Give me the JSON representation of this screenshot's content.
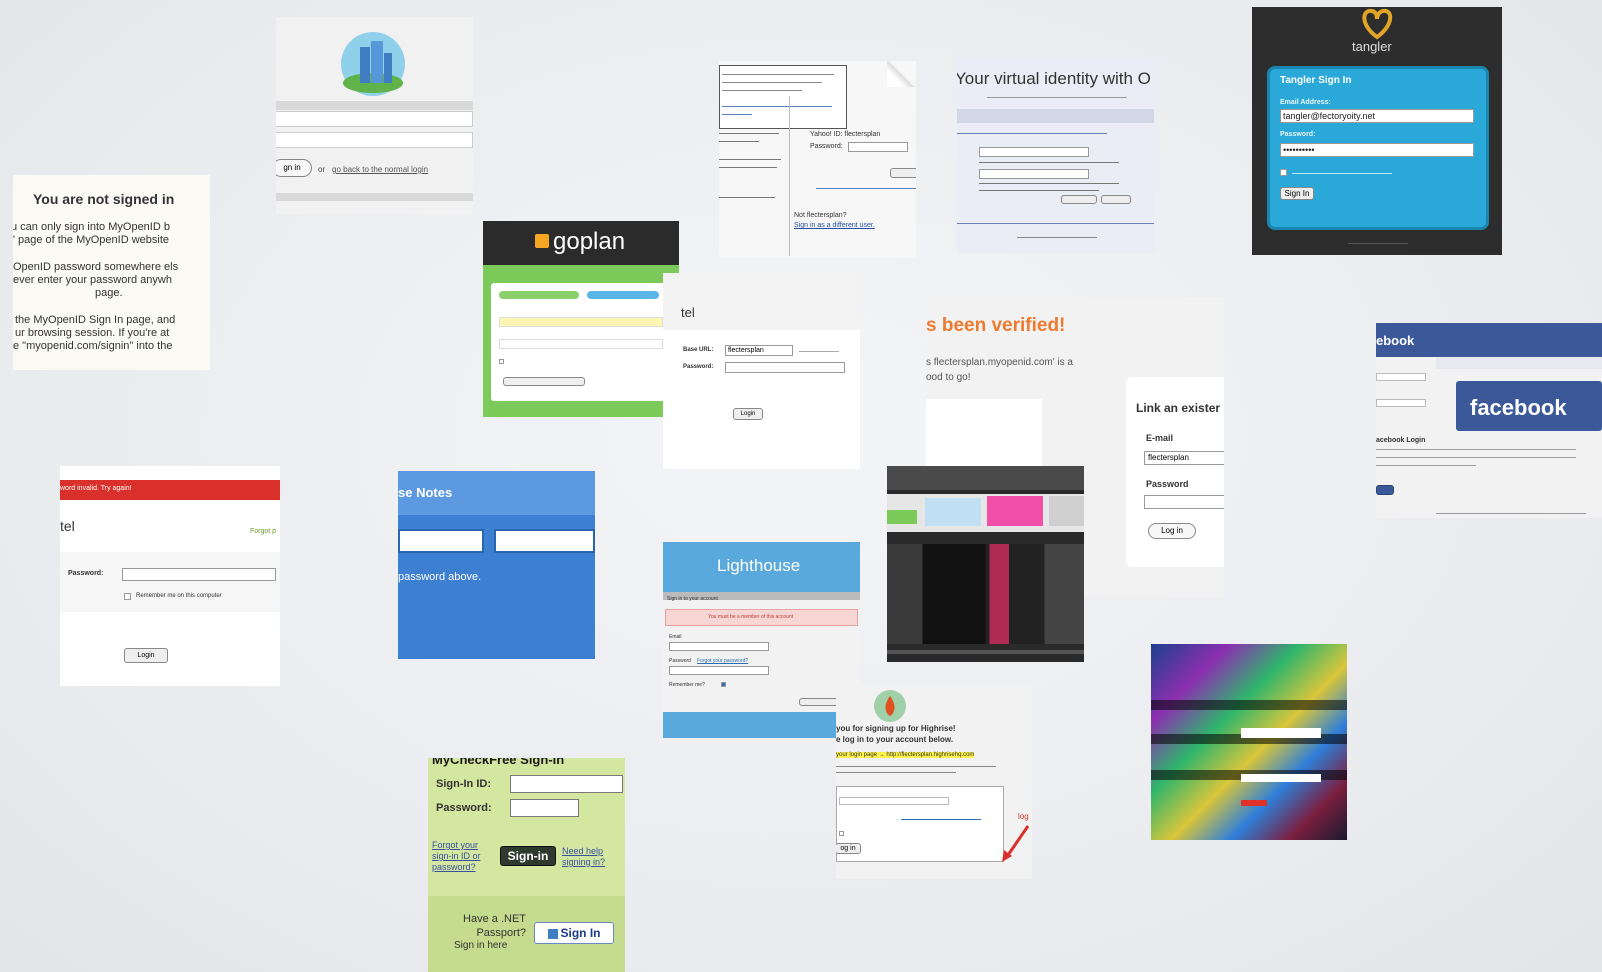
{
  "myopenid_notice": {
    "title": "You are not signed in",
    "lines": [
      "u can only sign into MyOpenID b",
      "\" page of the MyOpenID website",
      "OpenID password somewhere els",
      "ever enter your password anywh",
      "page.",
      "the MyOpenID Sign In page, and",
      "ur browsing session. If you're at",
      "e \"myopenid.com/signin\" into the"
    ]
  },
  "city_login": {
    "signin_button": "gn in",
    "or_text": "or",
    "back_link": "go back to the normal login"
  },
  "goplan": {
    "brand": "goplan"
  },
  "signup_paper": {
    "username_label": "Yahoo! ID: flectersplan",
    "password_label": "Password:",
    "new_link": "Not flectersplan?",
    "sign_in_link": "Sign in as a different user."
  },
  "openid_identity": {
    "heading": "Your virtual identity with O"
  },
  "tangler": {
    "brand": "tangler",
    "panel_title": "Tangler Sign In",
    "email_label": "Email Address:",
    "email_value": "tangler@fectoryoity.net",
    "password_label": "Password:",
    "password_value": "••••••••••",
    "signin_button": "Sign In"
  },
  "tel_login": {
    "heading": "tel",
    "base_url_label": "Base URL:",
    "base_url_value": "flectersplan",
    "password_label": "Password:",
    "login_button": "Login"
  },
  "verified": {
    "heading": "s been verified!",
    "subtitle": "s flectersplan.myopenid.com' is a",
    "subtitle2": "ood to go!",
    "panel_title": "Link an exister",
    "email_label": "E-mail",
    "email_value": "flectersplan",
    "password_label": "Password",
    "login_button": "Log in"
  },
  "facebook": {
    "nav_brand": "ebook",
    "logo": "facebook",
    "login_label": "acebook Login"
  },
  "red_login": {
    "error_bar": "word invalid. Try again!",
    "heading": "tel",
    "forgot": "Forgot p",
    "password_label": "Password:",
    "remember": "Remember me on this computer",
    "login_button": "Login"
  },
  "notes": {
    "heading": "se Notes",
    "message": "password above."
  },
  "lighthouse": {
    "brand": "Lighthouse",
    "section": "Sign in to your account",
    "error": "You must be a member of this account",
    "email_label": "Email",
    "password_label": "Password",
    "forgot_link": "Forgot your password?",
    "remember_label": "Remember me?"
  },
  "highrise": {
    "line1": "you for signing up for Highrise!",
    "line2": "e log in to your account below.",
    "highlight": "your login page → http://flectersplan.highrisehq.com",
    "signin_button": "og in",
    "arrow_label": "log"
  },
  "mycheckfree": {
    "heading": "MyCheckFree Sign-In",
    "signin_id_label": "Sign-In ID:",
    "password_label": "Password:",
    "forgot_link": "Forgot your sign-in ID or password?",
    "signin_button": "Sign-in",
    "help_link": "Need help signing in?",
    "passport_text": "Have a .NET Passport?",
    "passport_link": "Sign in here",
    "passport_button": "Sign In"
  },
  "colors": {
    "tangler_panel": "#2aa8d8",
    "goplan_green": "#7ccb5a",
    "facebook_blue": "#3b5998",
    "error_red": "#d9302b",
    "notes_blue": "#3d7fd1",
    "lighthouse_blue": "#5aa9dc",
    "checkfree_green": "#d3e7a0"
  }
}
